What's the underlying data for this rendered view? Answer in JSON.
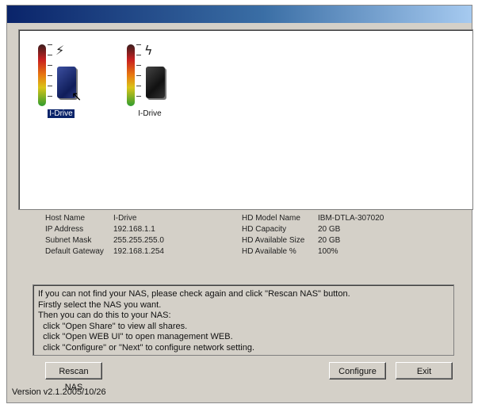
{
  "devices": [
    {
      "label": "I-Drive",
      "selected": true,
      "icon": "nas-drive-selected-icon"
    },
    {
      "label": "I-Drive",
      "selected": false,
      "icon": "nas-drive-icon"
    }
  ],
  "host_info": {
    "host_name_label": "Host Name",
    "host_name": "I-Drive",
    "ip_label": "IP Address",
    "ip": "192.168.1.1",
    "subnet_label": "Subnet Mask",
    "subnet": "255.255.255.0",
    "gateway_label": "Default Gateway",
    "gateway": "192.168.1.254"
  },
  "hd_info": {
    "model_label": "HD Model Name",
    "model": "IBM-DTLA-307020",
    "capacity_label": "HD Capacity",
    "capacity": "20 GB",
    "avail_size_label": "HD Available Size",
    "avail_size": "20 GB",
    "avail_pct_label": "HD Available %",
    "avail_pct": "100%"
  },
  "message_lines": [
    "If you can not find your NAS, please check again and click \"Rescan NAS\" button.",
    "Firstly select the NAS you want.",
    "Then you can do this to your NAS:",
    "  click \"Open Share\" to view all shares.",
    "  click \"Open WEB UI\" to open management WEB.",
    "  click \"Configure\" or \"Next\" to configure network setting."
  ],
  "buttons": {
    "rescan": "Rescan NAS",
    "configure": "Configure",
    "exit": "Exit"
  },
  "version": "Version v2.1.2005/10/26",
  "colors": {
    "titlebar_start": "#0a246a",
    "titlebar_end": "#a6caf0",
    "window_bg": "#d4d0c8",
    "selection": "#0a246a"
  }
}
